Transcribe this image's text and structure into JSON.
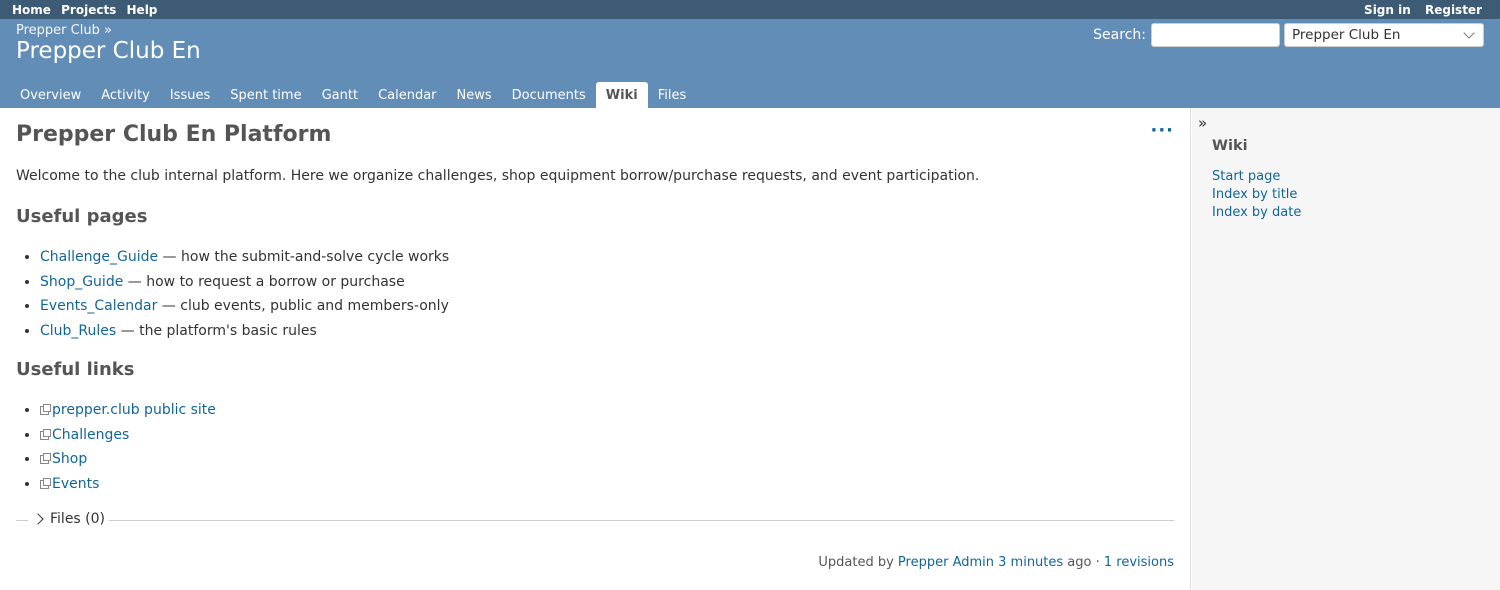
{
  "top_menu": {
    "left": [
      "Home",
      "Projects",
      "Help"
    ],
    "right": [
      "Sign in",
      "Register"
    ]
  },
  "header": {
    "breadcrumb": "Prepper Club »",
    "title": "Prepper Club En",
    "search_label": "Search:",
    "search_value": "",
    "project_jump": "Prepper Club En"
  },
  "tabs": [
    "Overview",
    "Activity",
    "Issues",
    "Spent time",
    "Gantt",
    "Calendar",
    "News",
    "Documents",
    "Wiki",
    "Files"
  ],
  "selected_tab": "Wiki",
  "content": {
    "title": "Prepper Club En Platform",
    "more_actions": "···",
    "intro": "Welcome to the club internal platform. Here we organize challenges, shop equipment borrow/purchase requests, and event participation.",
    "useful_pages_heading": "Useful pages",
    "useful_pages": [
      {
        "link": "Challenge_Guide",
        "desc": " — how the submit-and-solve cycle works"
      },
      {
        "link": "Shop_Guide",
        "desc": " — how to request a borrow or purchase"
      },
      {
        "link": "Events_Calendar",
        "desc": " — club events, public and members-only"
      },
      {
        "link": "Club_Rules",
        "desc": " — the platform's basic rules"
      }
    ],
    "useful_links_heading": "Useful links",
    "useful_links": [
      "prepper.club public site",
      "Challenges",
      "Shop",
      "Events"
    ],
    "files_legend": "Files (0)",
    "updated": {
      "prefix": "Updated by ",
      "author": "Prepper Admin",
      "time": "3 minutes",
      "middle": " ago · ",
      "revisions": "1 revisions"
    }
  },
  "sidebar": {
    "toggle": "»",
    "heading": "Wiki",
    "links": [
      "Start page",
      "Index by title",
      "Index by date"
    ]
  }
}
